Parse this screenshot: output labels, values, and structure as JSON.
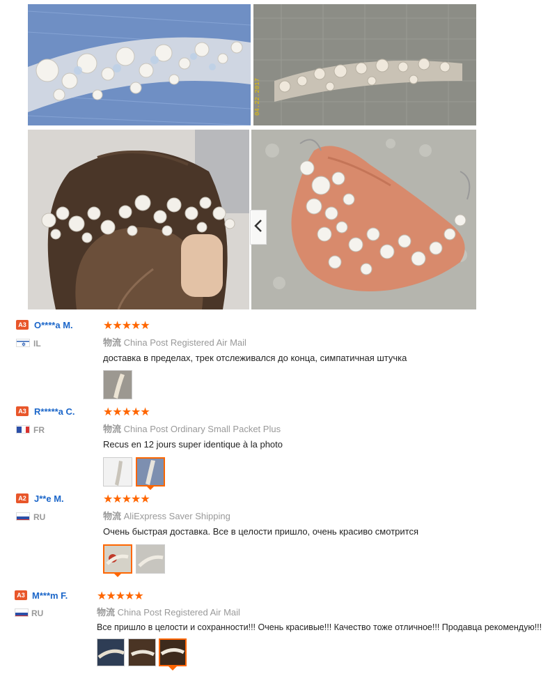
{
  "gallery": {
    "photos": [
      {
        "name": "pearl-headband-closeup-photo"
      },
      {
        "name": "pearl-headband-on-mat-photo",
        "stamp": "04.22.2017"
      },
      {
        "name": "pearl-headband-in-hair-photo"
      },
      {
        "name": "pearl-headband-in-hand-photo"
      }
    ],
    "prev_arrow_icon": "chevron-left-icon"
  },
  "reviews": [
    {
      "level": "A3",
      "level_color": "#e8562a",
      "name": "O****a M.",
      "country": "IL",
      "stars": "★★★★★",
      "ship_label": "物流",
      "ship_method": "China Post Registered Air Mail",
      "text": "доставка в пределах, трек отслеживался до конца, симпатичная штучка",
      "thumbs": [
        {
          "selected": false
        }
      ]
    },
    {
      "level": "A3",
      "level_color": "#e8562a",
      "name": "R*****a C.",
      "country": "FR",
      "stars": "★★★★★",
      "ship_label": "物流",
      "ship_method": "China Post Ordinary Small Packet Plus",
      "text": "Recus en 12 jours super identique à la photo",
      "thumbs": [
        {
          "selected": false
        },
        {
          "selected": true
        }
      ]
    },
    {
      "level": "A2",
      "level_color": "#e8562a",
      "name": "J**e M.",
      "country": "RU",
      "stars": "★★★★★",
      "ship_label": "物流",
      "ship_method": "AliExpress Saver Shipping",
      "text": "Очень быстрая доставка. Все в целости пришло, очень красиво смотрится",
      "thumbs": [
        {
          "selected": true
        },
        {
          "selected": false
        }
      ]
    },
    {
      "level": "A3",
      "level_color": "#e8562a",
      "name": "M***m F.",
      "country": "RU",
      "stars": "★★★★★",
      "ship_label": "物流",
      "ship_method": "China Post Registered Air Mail",
      "text": "Все пришло в целости и сохранности!!! Очень красивые!!! Качество тоже отличное!!! Продавца рекомендую!!!",
      "thumbs": [
        {
          "selected": false
        },
        {
          "selected": false
        },
        {
          "selected": true
        }
      ]
    }
  ],
  "colors": {
    "accent": "#ff6600",
    "name_link": "#1b66c9",
    "star": "#ff6600"
  }
}
